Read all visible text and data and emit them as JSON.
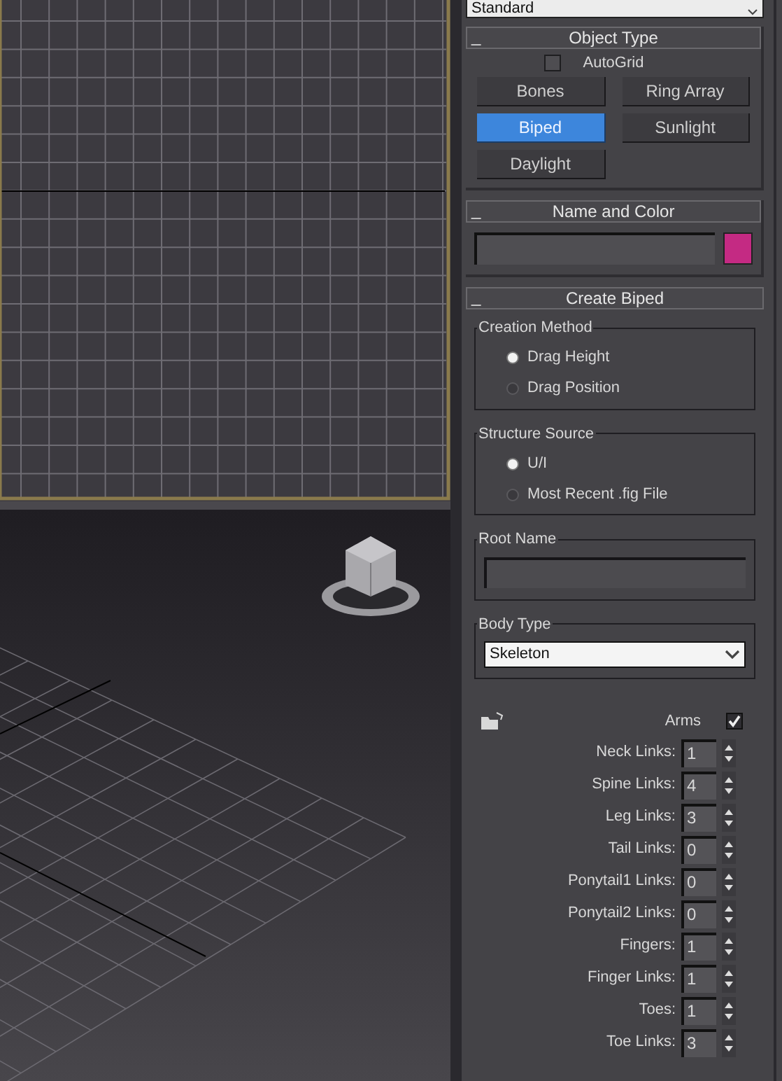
{
  "top_dropdown": {
    "value": "Standard"
  },
  "object_type": {
    "collapse_mark": "_",
    "title": "Object Type",
    "autogrid": {
      "label": "AutoGrid",
      "checked": false
    },
    "buttons": [
      {
        "label": "Bones",
        "selected": false
      },
      {
        "label": "Ring Array",
        "selected": false
      },
      {
        "label": "Biped",
        "selected": true
      },
      {
        "label": "Sunlight",
        "selected": false
      },
      {
        "label": "Daylight",
        "selected": false
      }
    ]
  },
  "name_and_color": {
    "collapse_mark": "_",
    "title": "Name and Color",
    "color": "#c42a83"
  },
  "create_biped": {
    "collapse_mark": "_",
    "title": "Create Biped",
    "groups": [
      {
        "title": "Creation Method",
        "options": [
          {
            "label": "Drag Height",
            "selected": true
          },
          {
            "label": "Drag Position",
            "selected": false
          }
        ]
      },
      {
        "title": "Structure Source",
        "options": [
          {
            "label": "U/I",
            "selected": true
          },
          {
            "label": "Most Recent .fig File",
            "selected": false
          }
        ]
      }
    ],
    "root_name": {
      "title": "Root Name"
    },
    "body_type": {
      "title": "Body Type",
      "value": "Skeleton"
    },
    "arms": {
      "label": "Arms",
      "checked": true
    },
    "links": [
      {
        "label": "Neck Links:",
        "value": "1"
      },
      {
        "label": "Spine Links:",
        "value": "4"
      },
      {
        "label": "Leg Links:",
        "value": "3"
      },
      {
        "label": "Tail Links:",
        "value": "0"
      },
      {
        "label": "Ponytail1 Links:",
        "value": "0"
      },
      {
        "label": "Ponytail2 Links:",
        "value": "0"
      },
      {
        "label": "Fingers:",
        "value": "1"
      },
      {
        "label": "Finger Links:",
        "value": "1"
      },
      {
        "label": "Toes:",
        "value": "1"
      },
      {
        "label": "Toe Links:",
        "value": "3"
      }
    ]
  }
}
